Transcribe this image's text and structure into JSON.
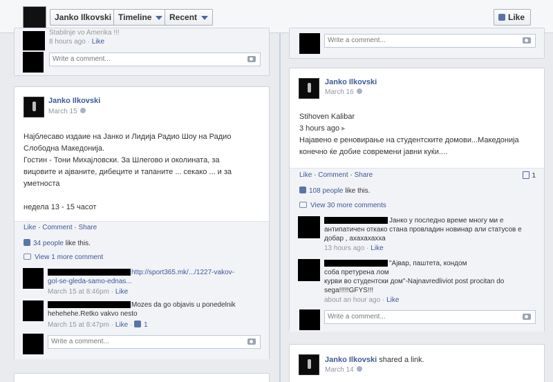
{
  "header": {
    "name": "Janko Ilkovski",
    "timeline_label": "Timeline",
    "recent_label": "Recent",
    "like_label": "Like"
  },
  "left_top": {
    "partial_text": "Stabilnje vo Amerika !!!",
    "time": "8 hours ago",
    "like": "Like",
    "input_placeholder": "Write a comment..."
  },
  "left_post": {
    "author": "Janko Ilkovski",
    "date": "March 15",
    "body_lines": [
      "Најблесаво издаие на Јанко и Лидија Радио Шоу на Радио",
      "Слободна Македонија.",
      "Гостин - Тони Михајловски. За Шлегово и околината, за",
      "вицовите и ајваните, дибеците и тапаните ... секако ... и за",
      "уметноста",
      "",
      "недела 13 - 15 часот"
    ],
    "actions": {
      "like": "Like",
      "comment": "Comment",
      "share": "Share"
    },
    "likes_count": "34 people",
    "likes_suffix": "like this.",
    "view_more": "View 1 more comment",
    "comments": [
      {
        "text_line1": "http://sport365.mk/.../1227-vakov-",
        "text_line2": "gol-se-gleda-samo-ednas...",
        "meta": "March 15 at 8:46pm",
        "like": "Like"
      },
      {
        "text_line1": "Mozes da go objavis u ponedelnik",
        "text_line2": "hehehehe.Retko vakvo nesto",
        "meta": "March 15 at 8:47pm",
        "like": "Like",
        "like_count": "1"
      }
    ],
    "input_placeholder": "Write a comment..."
  },
  "right_top": {
    "input_placeholder": "Write a comment..."
  },
  "right_post": {
    "author": "Janko Ilkovski",
    "date": "March 16",
    "shared_title": "Stihoven Kalibar",
    "shared_time": "3 hours ago",
    "body_lines": [
      "Најавено е реновирање на студентските домови...Македонија",
      "конечно ќе добие современи јавни куќи...."
    ],
    "actions": {
      "like": "Like",
      "comment": "Comment",
      "share": "Share"
    },
    "comment_count": "1",
    "likes_count": "108 people",
    "likes_suffix": "like this.",
    "view_more": "View 30 more comments",
    "comments": [
      {
        "lines": [
          "Јанко у последно време многу ми е",
          "антипатичен откако стана провладин новинар али статусов е",
          "добар , ахахахахха"
        ],
        "meta": "13 hours ago",
        "like": "Like"
      },
      {
        "lines": [
          "\"Ајвар, паштета, кондом",
          "соба претурена лом",
          "курви во студентски дом\"-Najnavredliviot post procitan do",
          "sega!!!!!GFYS!!!"
        ],
        "meta": "about an hour ago",
        "like": "Like"
      }
    ],
    "input_placeholder": "Write a comment..."
  },
  "right_bottom": {
    "author": "Janko Ilkovski",
    "action": "shared a link.",
    "date": "March 14"
  }
}
